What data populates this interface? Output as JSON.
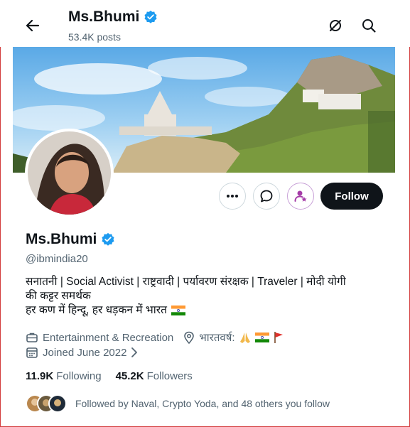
{
  "topbar": {
    "name": "Ms.Bhumi",
    "posts": "53.4K posts",
    "icons": [
      "back-arrow-icon",
      "grok-icon",
      "search-icon"
    ]
  },
  "profile": {
    "name": "Ms.Bhumi",
    "handle": "@ibmindia20",
    "verified_color": "#1d9bf0",
    "bio_line1": "सनातनी | Social Activist | राष्ट्रवादी | पर्यावरण संरक्षक | Traveler | मोदी योगी",
    "bio_line2": "की कट्टर समर्थक",
    "bio_line3": "हर कण में हिन्दू, हर धड़कन में भारत",
    "category": "Entertainment & Recreation",
    "location": "भारतवर्ष:",
    "joined": "Joined June 2022",
    "following_count": "11.9K",
    "following_label": "Following",
    "followers_count": "45.2K",
    "followers_label": "Followers",
    "followed_by": "Followed by Naval, Crypto Yoda, and 48 others you follow"
  },
  "actions": {
    "follow_label": "Follow",
    "icons": [
      "more-icon",
      "message-icon",
      "subscribe-icon"
    ]
  },
  "colors": {
    "accent": "#1d9bf0",
    "follow_bg": "#0f1419",
    "secondary_text": "#536471"
  }
}
